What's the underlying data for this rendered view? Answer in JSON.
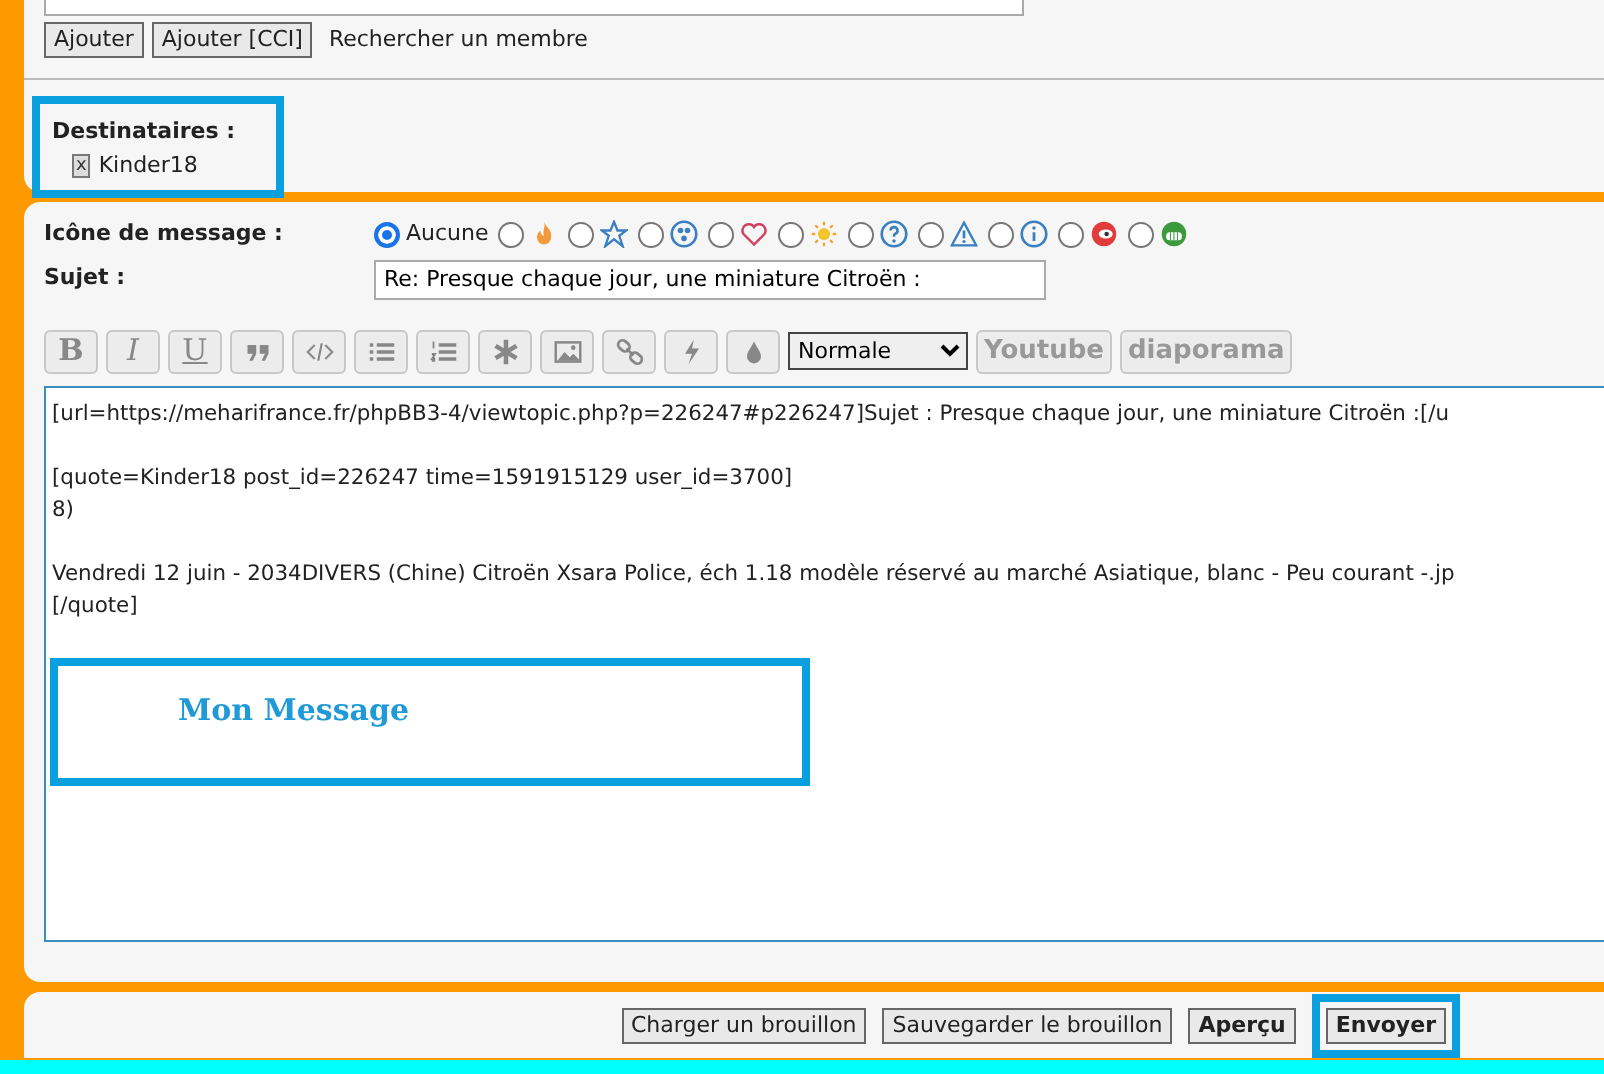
{
  "member_search": {
    "buttons": [
      "Ajouter",
      "Ajouter [CCI]"
    ],
    "link": "Rechercher un membre"
  },
  "recipients": {
    "label": "Destinataires :",
    "highlighted": true,
    "members": [
      {
        "name": "Kinder18",
        "remove": "x"
      }
    ]
  },
  "message_icon": {
    "label": "Icône de message :",
    "options": [
      {
        "kind": "none",
        "label": "Aucune",
        "selected": true
      },
      {
        "kind": "fire",
        "selected": false
      },
      {
        "kind": "star",
        "selected": false
      },
      {
        "kind": "radioactive",
        "selected": false
      },
      {
        "kind": "heart",
        "selected": false
      },
      {
        "kind": "bulb",
        "selected": false
      },
      {
        "kind": "question",
        "selected": false
      },
      {
        "kind": "warning",
        "selected": false
      },
      {
        "kind": "info",
        "selected": false
      },
      {
        "kind": "mad",
        "selected": false
      },
      {
        "kind": "grin",
        "selected": false
      }
    ]
  },
  "subject": {
    "label": "Sujet :",
    "value": "Re: Presque chaque jour, une miniature Citroën :"
  },
  "toolbar": {
    "buttons": [
      {
        "kind": "bold",
        "label": "B"
      },
      {
        "kind": "italic",
        "label": "I"
      },
      {
        "kind": "underline",
        "label": "U"
      },
      {
        "kind": "quote"
      },
      {
        "kind": "code"
      },
      {
        "kind": "list"
      },
      {
        "kind": "ordered-list"
      },
      {
        "kind": "asterisk"
      },
      {
        "kind": "image"
      },
      {
        "kind": "link"
      },
      {
        "kind": "flash"
      },
      {
        "kind": "drop"
      }
    ],
    "font_size": "Normale",
    "extra_buttons": [
      "Youtube",
      "diaporama"
    ]
  },
  "editor": {
    "paragraphs": [
      [
        "[url=https://meharifrance.fr/phpBB3-4/viewtopic.php?p=226247#p226247]Sujet : Presque chaque jour, une miniature Citroën :[/u"
      ],
      [
        "[quote=Kinder18 post_id=226247 time=1591915129 user_id=3700]",
        "8)"
      ],
      [
        "Vendredi 12 juin  - 2034DIVERS (Chine) Citroën Xsara Police, éch 1.18 modèle réservé au marché Asiatique, blanc - Peu courant -.jp",
        "[/quote]"
      ]
    ],
    "note": "Mon Message"
  },
  "actions": [
    {
      "label": "Charger un brouillon",
      "primary": false,
      "highlighted": false
    },
    {
      "label": "Sauvegarder le brouillon",
      "primary": false,
      "highlighted": false
    },
    {
      "label": "Aperçu",
      "primary": true,
      "highlighted": false
    },
    {
      "label": "Envoyer",
      "primary": true,
      "highlighted": true
    }
  ]
}
